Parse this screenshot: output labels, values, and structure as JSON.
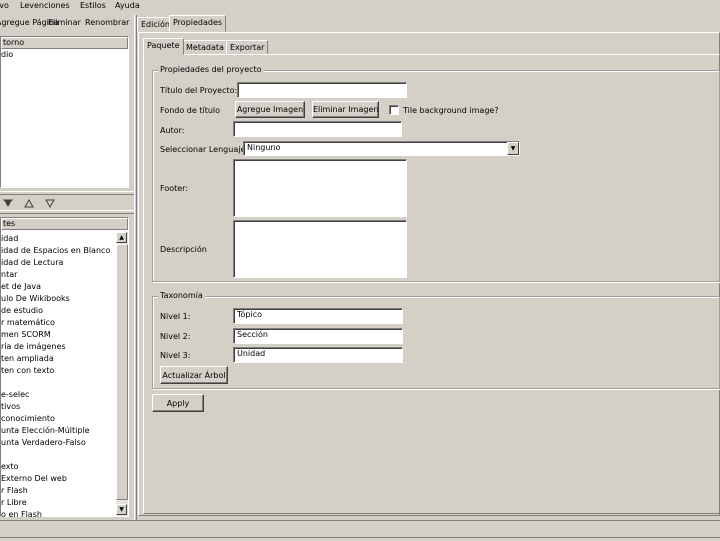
{
  "menu": [
    "ivo",
    "Levenciones",
    "Estilos",
    "Ayuda"
  ],
  "outline": {
    "toolbar": [
      "Agregue Página",
      "Eliminar",
      "Renombrar"
    ],
    "header": "torno",
    "items": [
      "dio"
    ]
  },
  "idevices": {
    "header": "tes",
    "items": [
      "idad",
      "idad de Espacios en Blanco",
      "idad de Lectura",
      "ntar",
      "et de Java",
      "ulo De Wikibooks",
      "de estudio",
      "r matemático",
      "men SCORM",
      "ría de imágenes",
      "ten ampliada",
      "ten con texto",
      "",
      "e-selec",
      "tivos",
      "conocimiento",
      "unta Elección-Múltiple",
      "unta Verdadero-Falso",
      "",
      "exto",
      "Externo Del web",
      "r Flash",
      "r Libre",
      "o en Flash"
    ]
  },
  "main_tabs": [
    "Edición",
    "Propiedades"
  ],
  "sub_tabs": [
    "Paquete",
    "Metadata",
    "Exportar"
  ],
  "project_group": {
    "title": "Propiedades del proyecto",
    "title_label": "Título del Proyecto:",
    "title_value": "",
    "background_label": "Fondo de título",
    "add_image": "Agregue Imagen",
    "remove_image": "Eliminar Imagen",
    "tile_label": "Tile background image?",
    "author_label": "Autor:",
    "author_value": "",
    "language_label": "Seleccionar Lenguaje",
    "language_value": "Ninguno",
    "footer_label": "Footer:",
    "description_label": "Descripción"
  },
  "taxonomy": {
    "title": "Taxonomía",
    "level1_label": "Nivel 1:",
    "level1_value": "Tópico",
    "level2_label": "Nivel 2:",
    "level2_value": "Sección",
    "level3_label": "Nivel 3:",
    "level3_value": "Unidad",
    "update_button": "Actualizar Árbol"
  },
  "apply_button": "Apply"
}
